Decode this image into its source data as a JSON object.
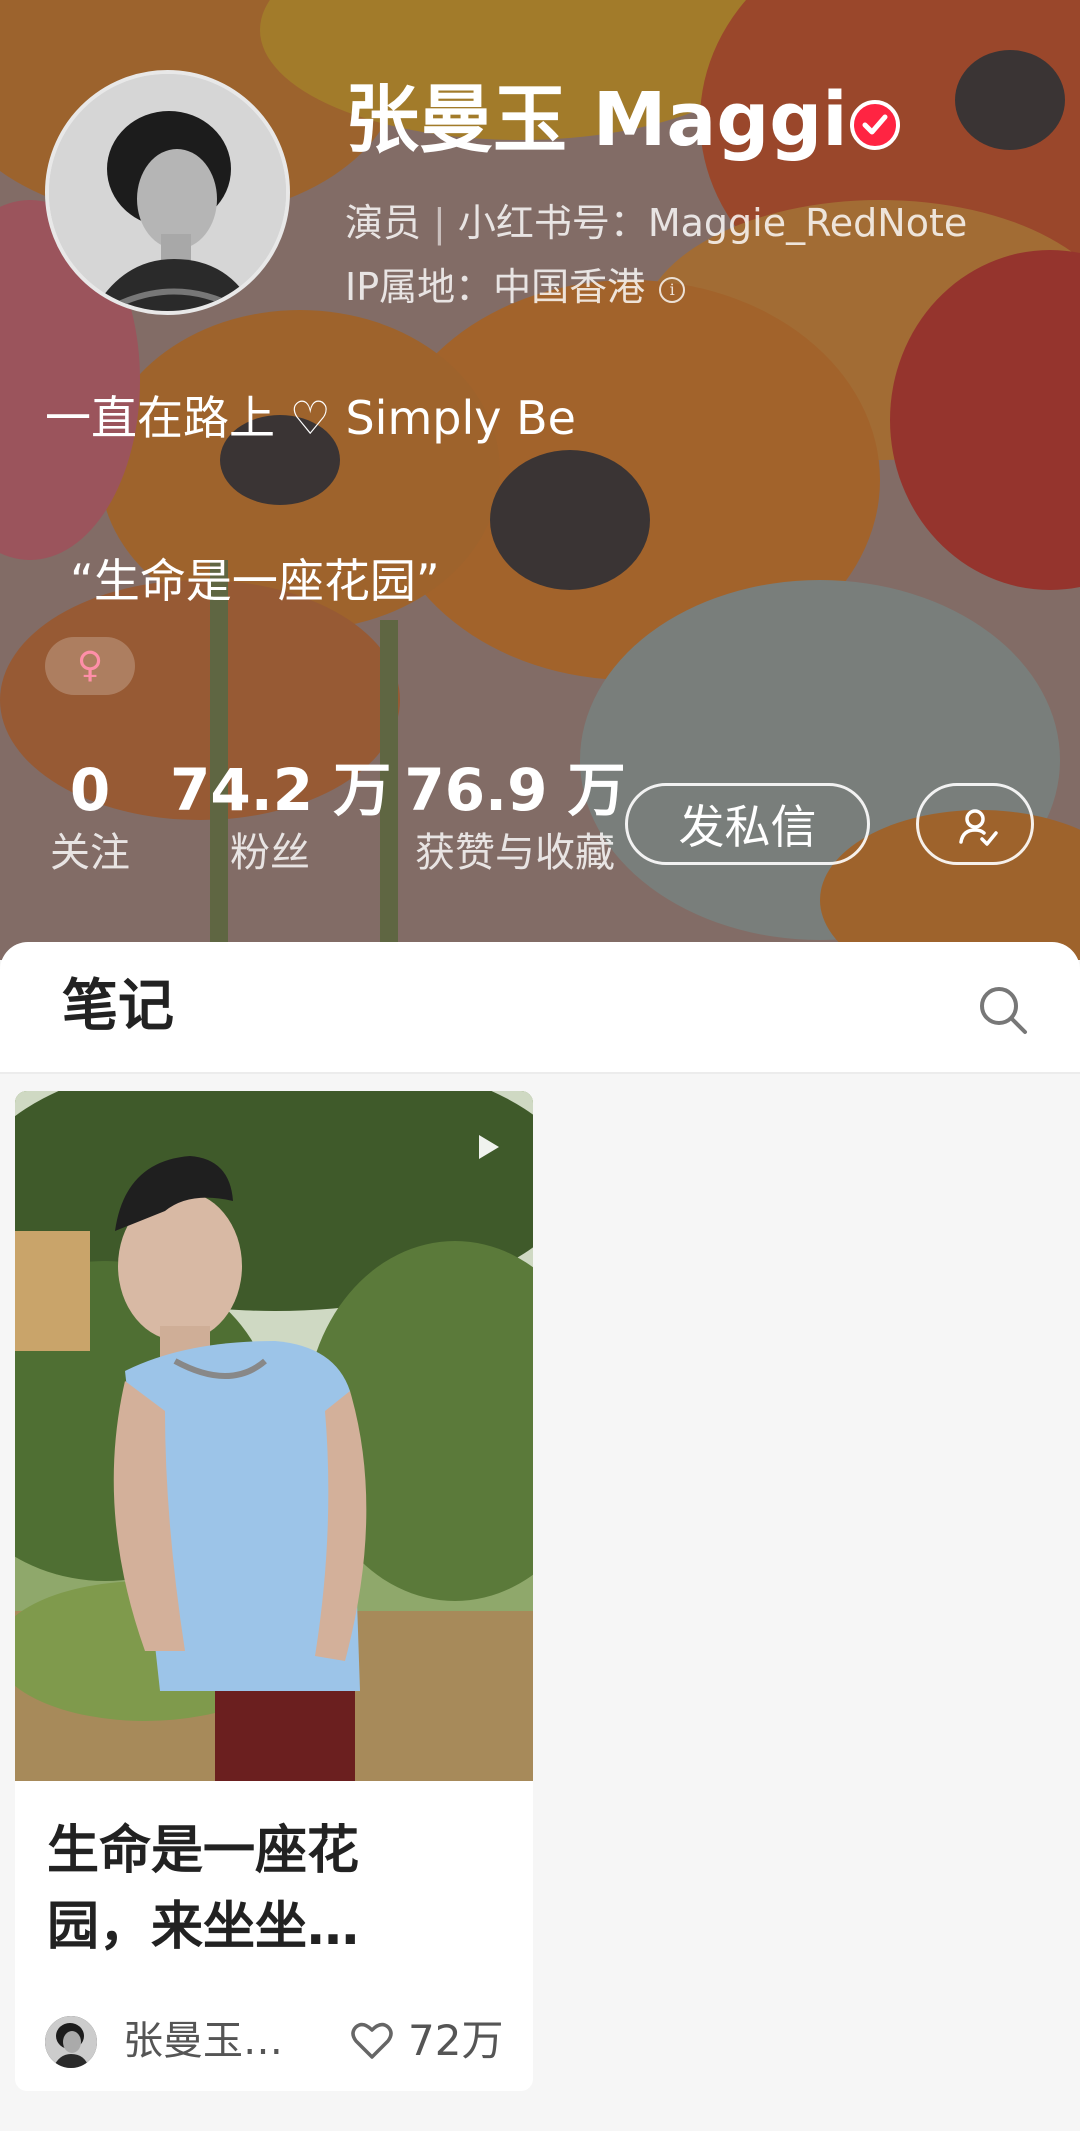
{
  "profile": {
    "name": "张曼玉 Maggie",
    "role": "演员",
    "separator": "|",
    "redbook_id": "小红书号：Maggie_RedNote",
    "ip_location": "IP属地：中国香港",
    "bio_line1": "一直在路上 ♡ Simply Be",
    "bio_line2": "“生命是一座花园”",
    "gender_symbol": "♀",
    "verified_color": "#ff2442"
  },
  "stats": [
    {
      "value": "0",
      "label": "关注"
    },
    {
      "value": "74.2 万",
      "label": "粉丝"
    },
    {
      "value": "76.9 万",
      "label": "获赞与收藏"
    }
  ],
  "actions": {
    "message_label": "发私信",
    "follow_icon": "user-check-icon"
  },
  "notes": {
    "section_title": "笔记",
    "search_icon": "search-icon",
    "cards": [
      {
        "title_line1": "生命是一座花",
        "title_line2": "园，来坐坐…",
        "author": "张曼玉…",
        "likes": "72万",
        "is_video": true
      }
    ]
  }
}
